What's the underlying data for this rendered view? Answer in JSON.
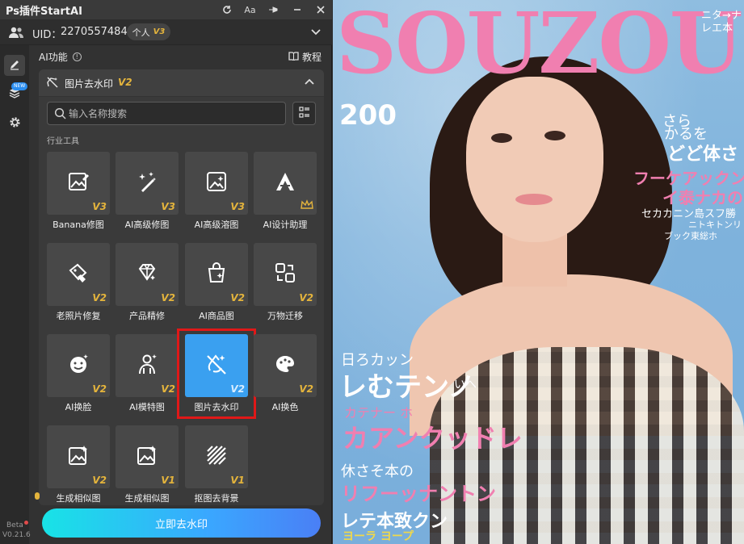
{
  "app": {
    "title": "Ps插件StartAI",
    "title_icons": [
      "refresh-icon",
      "font-size-icon",
      "pin-icon",
      "minimize-icon",
      "close-icon"
    ],
    "font_size_label": "Aa"
  },
  "user": {
    "uid_label": "UID：",
    "uid_value": "2270557484",
    "plan_label": "个人",
    "plan_version": "V3"
  },
  "sidebar": {
    "new_tag": "NEW",
    "beta_label": "Beta",
    "version": "V0.21.6"
  },
  "section_header": {
    "title": "AI功能",
    "tutorial_label": "教程"
  },
  "tool_panel": {
    "title": "图片去水印",
    "version": "V2",
    "search_placeholder": "输入名称搜索",
    "category_label": "行业工具",
    "tools": [
      {
        "label": "Banana修图",
        "version": "V3",
        "icon": "image-edit-icon"
      },
      {
        "label": "AI高级修图",
        "version": "V3",
        "icon": "magic-wand-icon"
      },
      {
        "label": "AI高级溶图",
        "version": "V3",
        "icon": "image-sparkle-icon"
      },
      {
        "label": "AI设计助理",
        "version": "",
        "icon": "design-assistant-icon"
      },
      {
        "label": "老照片修复",
        "version": "V2",
        "icon": "photo-repair-icon"
      },
      {
        "label": "产品精修",
        "version": "V2",
        "icon": "gem-icon"
      },
      {
        "label": "AI商品图",
        "version": "V2",
        "icon": "shopping-bag-icon"
      },
      {
        "label": "万物迁移",
        "version": "V2",
        "icon": "transfer-icon"
      },
      {
        "label": "AI换脸",
        "version": "V2",
        "icon": "face-icon"
      },
      {
        "label": "AI模特图",
        "version": "V2",
        "icon": "model-icon"
      },
      {
        "label": "图片去水印",
        "version": "V2",
        "icon": "watermark-remove-icon",
        "selected": true
      },
      {
        "label": "AI换色",
        "version": "V2",
        "icon": "palette-icon"
      },
      {
        "label": "生成相似图",
        "version": "V2",
        "icon": "similar-image-icon"
      },
      {
        "label": "生成相似图",
        "version": "V1",
        "icon": "similar-image-icon"
      },
      {
        "label": "抠图去背景",
        "version": "V1",
        "icon": "remove-background-icon"
      }
    ]
  },
  "action": {
    "label": "立即去水印"
  },
  "cover": {
    "masthead": "SOUZOUL",
    "number": "200",
    "top_right_1": "ニタ→ナ",
    "top_right_2": "レエ本",
    "r1": "さら",
    "r2": "かるを",
    "r3": "どど体さ",
    "r4": "フーケアックン",
    "r5": "イ泰ナカの",
    "r6": "セカカニン島スフ勝",
    "r7": "ニトキトンリ",
    "r8": "ブック東総ホ",
    "l1": "日ろカッン",
    "l2": "レむテンノ",
    "l2b": "いへ",
    "l3": "カテナー ホ",
    "l4": "カアンクッドレ",
    "l5": "休さそ本の",
    "l6": "リフーッナントン",
    "l7": "レテ本致クン",
    "l8": "ヨーラ ヨープ",
    "colors": {
      "pink": "#f07fb0",
      "white": "#ffffff",
      "yellow": "#f0d84a"
    }
  }
}
